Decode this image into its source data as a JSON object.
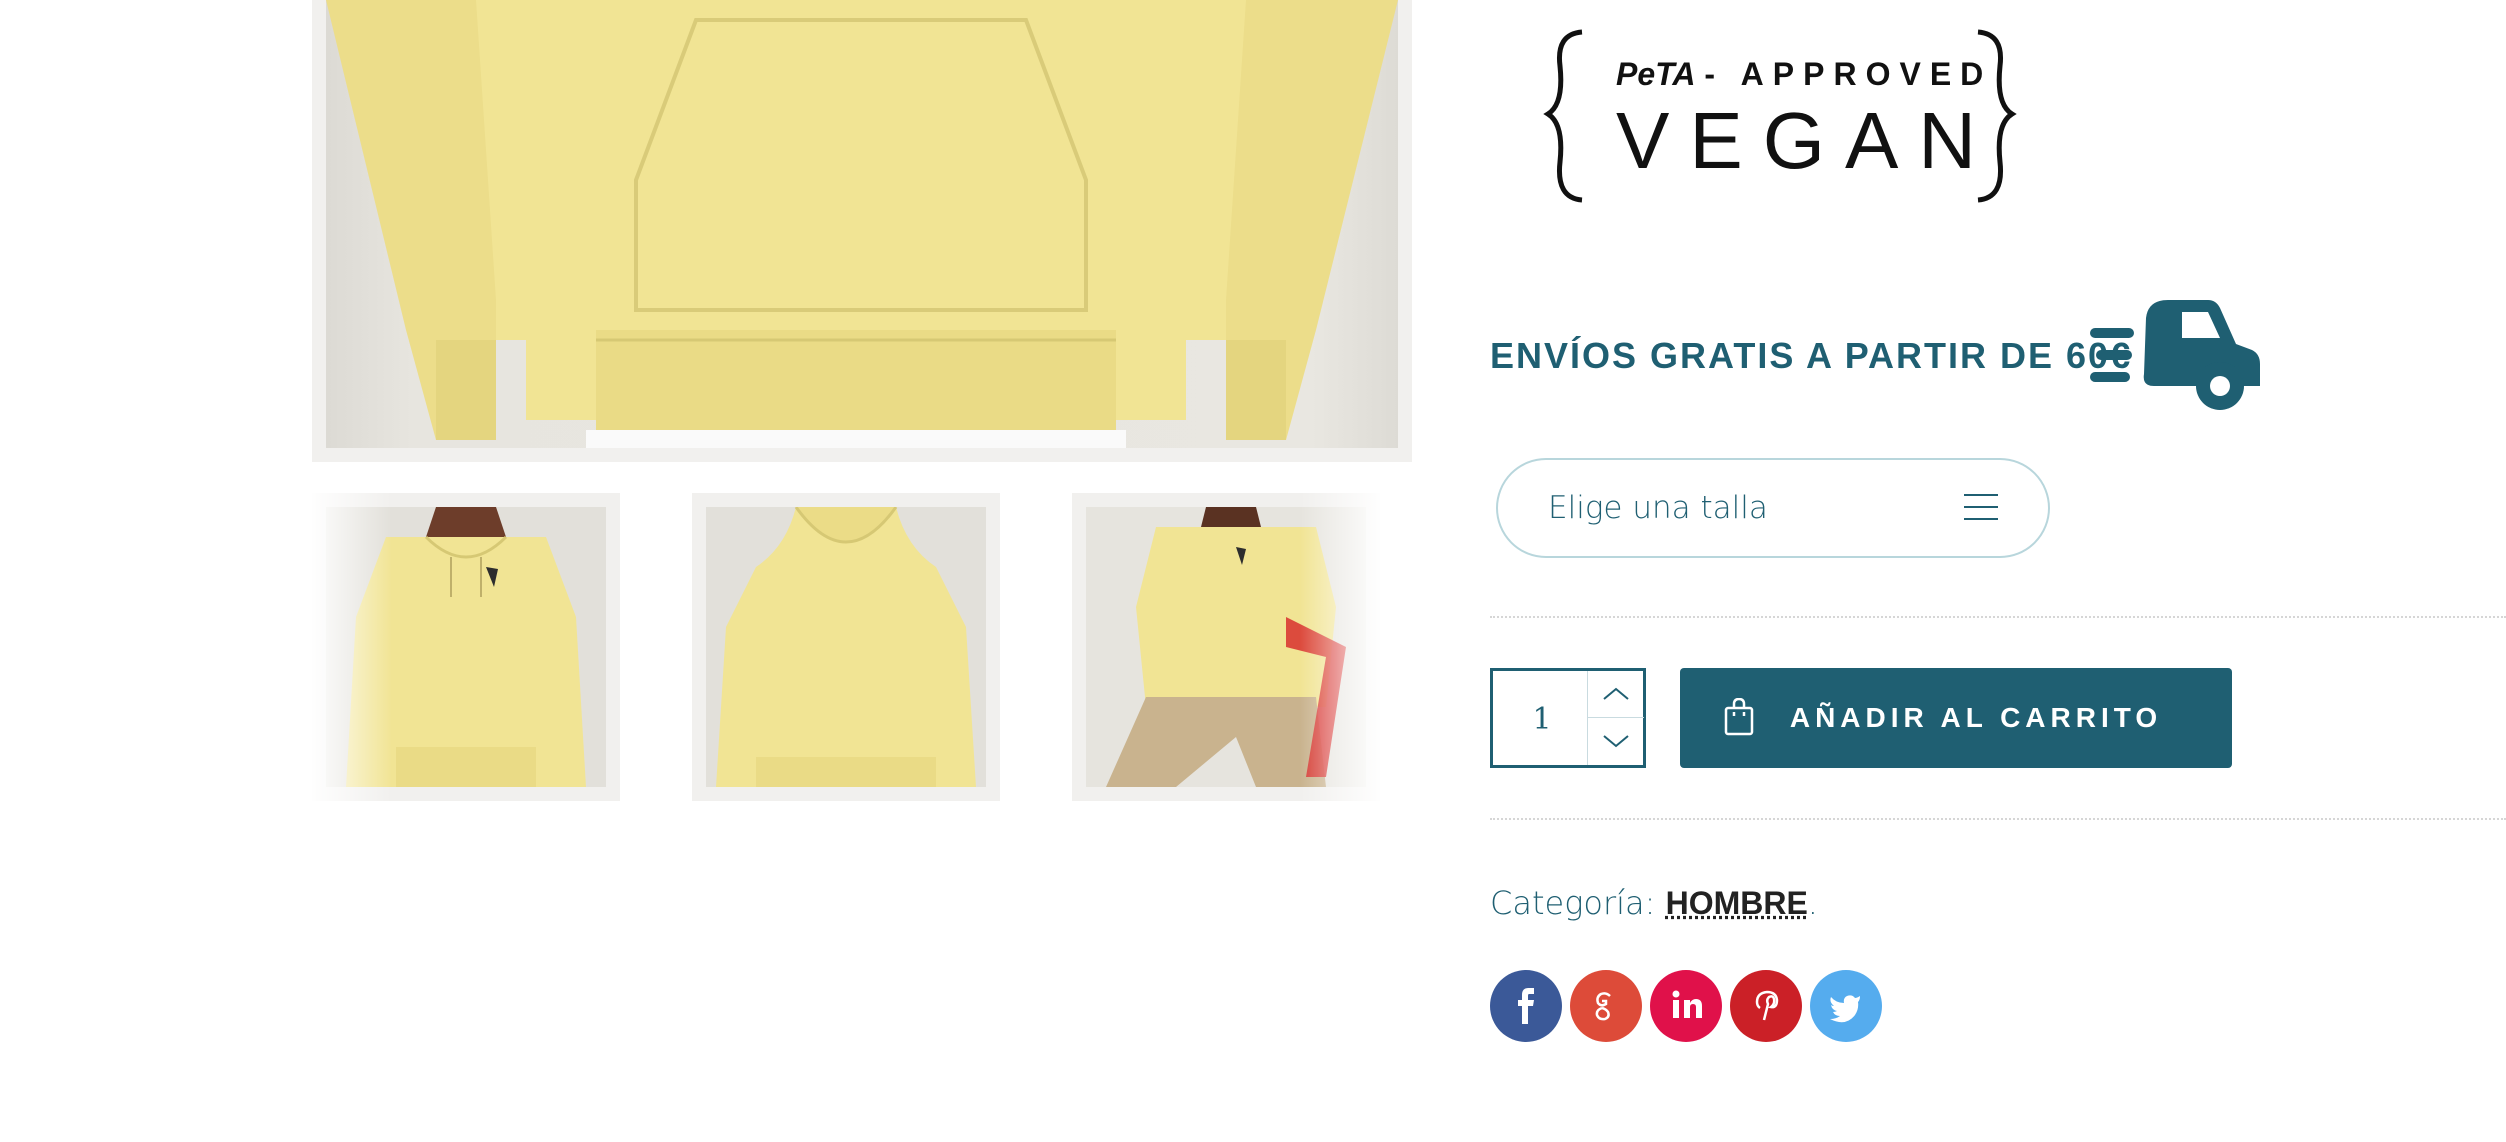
{
  "badge": {
    "line1_brand": "PeTA",
    "line1_rest": "- APPROVED",
    "line2": "VEGAN"
  },
  "shipping": {
    "text": "ENVÍOS GRATIS A PARTIR DE 60€",
    "icon": "delivery-truck-icon"
  },
  "size_select": {
    "placeholder": "Elige una talla",
    "icon": "menu-lines-icon"
  },
  "quantity": {
    "value": "1"
  },
  "cart": {
    "label": "AÑADIR AL CARRITO",
    "icon": "shopping-bag-icon"
  },
  "category": {
    "label": "Categoría:",
    "value": "HOMBRE",
    "suffix": "."
  },
  "social": [
    {
      "name": "facebook",
      "icon": "facebook-icon",
      "color": "#3b5998"
    },
    {
      "name": "google-plus",
      "icon": "google-plus-icon",
      "color": "#dd4b39"
    },
    {
      "name": "linkedin",
      "icon": "linkedin-icon",
      "color": "#e0114a"
    },
    {
      "name": "pinterest",
      "icon": "pinterest-icon",
      "color": "#cb2027"
    },
    {
      "name": "twitter",
      "icon": "twitter-icon",
      "color": "#55acee"
    }
  ],
  "colors": {
    "primary": "#1f5f72",
    "hoodie": "#f1e494"
  }
}
